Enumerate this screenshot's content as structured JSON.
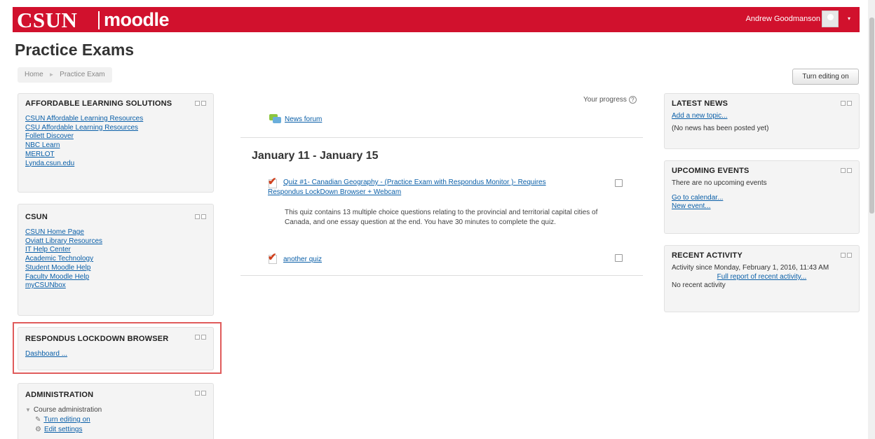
{
  "header": {
    "logo_csun": "CSUN",
    "logo_moodle": "moodle",
    "user_name": "Andrew Goodmanson",
    "user_caret": "▾",
    "brand_color": "#d1112d"
  },
  "page": {
    "title": "Practice Exams",
    "breadcrumb": [
      "Home",
      "Practice Exam"
    ],
    "breadcrumb_sep": "►",
    "turn_editing_label": "Turn editing on"
  },
  "blocks": {
    "als": {
      "title": "AFFORDABLE LEARNING SOLUTIONS",
      "links": [
        "CSUN Affordable Learning Resources",
        "CSU Affordable Learning Resources",
        "Follett Discover",
        "NBC Learn",
        "MERLOT",
        "Lynda.csun.edu"
      ]
    },
    "csun": {
      "title": "CSUN",
      "links": [
        "CSUN Home Page",
        "Oviatt Library Resources",
        "IT Help Center",
        "Academic Technology",
        "Student Moodle Help",
        "Faculty Moodle Help",
        "myCSUNbox"
      ]
    },
    "respondus": {
      "title": "RESPONDUS LOCKDOWN BROWSER",
      "link": "Dashboard ..."
    },
    "admin": {
      "title": "ADMINISTRATION",
      "course_admin": "Course administration",
      "items": [
        "Turn editing on",
        "Edit settings"
      ]
    },
    "news": {
      "title": "LATEST NEWS",
      "add_link": "Add a new topic...",
      "empty": "(No news has been posted yet)"
    },
    "events": {
      "title": "UPCOMING EVENTS",
      "empty": "There are no upcoming events",
      "links": [
        "Go to calendar...",
        "New event..."
      ]
    },
    "activity": {
      "title": "RECENT ACTIVITY",
      "since": "Activity since Monday, February 1, 2016, 11:43 AM",
      "full_report": "Full report of recent activity...",
      "empty": "No recent activity"
    }
  },
  "course": {
    "your_progress": "Your progress",
    "help_glyph": "?",
    "forum": "News forum",
    "section_title": "January 11 - January 15",
    "quiz1": {
      "line1": "Quiz #1- Canadian Geography - (Practice Exam with Respondus Monitor )- Requires",
      "line2": "Respondus LockDown Browser + Webcam",
      "desc": "This quiz contains 13 multiple choice questions relating to the provincial and territorial capital cities of Canada, and one essay question at the end. You have 30 minutes to complete the quiz."
    },
    "quiz2": "another quiz"
  }
}
